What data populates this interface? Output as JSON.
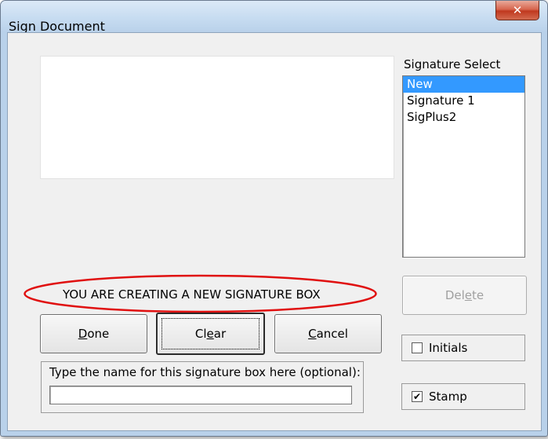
{
  "window": {
    "title": "Sign Document",
    "close_glyph": "✕"
  },
  "signature_select": {
    "label": "Signature Select",
    "items": [
      "New",
      "Signature 1",
      "SigPlus2"
    ],
    "selected_index": 0
  },
  "buttons": {
    "delete": {
      "pre": "Del",
      "acc": "e",
      "post": "te"
    },
    "done": {
      "pre": "",
      "acc": "D",
      "post": "one"
    },
    "clear": {
      "pre": "Cl",
      "acc": "e",
      "post": "ar"
    },
    "cancel": {
      "pre": "",
      "acc": "C",
      "post": "ancel"
    }
  },
  "status_message": "YOU ARE CREATING A NEW SIGNATURE BOX",
  "options": {
    "initials": {
      "label": "Initials",
      "checked": false,
      "mark": ""
    },
    "stamp": {
      "label": "Stamp",
      "checked": true,
      "mark": "✔"
    }
  },
  "name_group": {
    "label": "Type the name for this signature box here (optional):",
    "value": ""
  },
  "colors": {
    "selection": "#3399ff",
    "highlight_oval": "#e01010",
    "close_button": "#c0391f"
  }
}
